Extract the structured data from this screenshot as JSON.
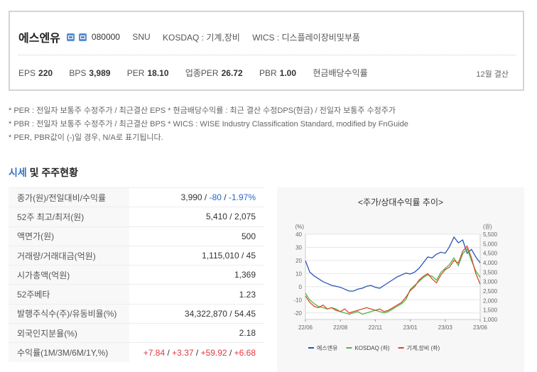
{
  "company": {
    "name": "에스엔유",
    "code": "080000",
    "eng": "SNU",
    "market": "KOSDAQ : 기계,장비",
    "wics": "WICS : 디스플레이장비및부품"
  },
  "metrics": [
    {
      "key": "EPS",
      "val": "220"
    },
    {
      "key": "BPS",
      "val": "3,989"
    },
    {
      "key": "PER",
      "val": "18.10"
    },
    {
      "key": "업종PER",
      "val": "26.72"
    },
    {
      "key": "PBR",
      "val": "1.00"
    },
    {
      "key": "현금배당수익률",
      "val": ""
    }
  ],
  "fiscal": "12월 결산",
  "notes": [
    "* PER : 전일자 보통주 수정주가 / 최근결산 EPS * 현금배당수익률 : 최근 결산 수정DPS(현금) / 전일자 보통주 수정주가",
    "* PBR : 전일자 보통주 수정주가 / 최근결산 BPS * WICS : WISE Industry Classification Standard, modified by FnGuide",
    "* PER, PBR값이 (-)일 경우, N/A로 표기됩니다."
  ],
  "section": {
    "a": "시세",
    "b": " 및 주주현황"
  },
  "rows": [
    {
      "label": "종가(원)/전일대비/수익률",
      "v1": "3,990",
      "v2": "-80",
      "v3": "-1.97%"
    },
    {
      "label": "52주 최고/최저(원)",
      "value": "5,410 / 2,075"
    },
    {
      "label": "액면가(원)",
      "value": "500"
    },
    {
      "label": "거래량/거래대금(억원)",
      "value": "1,115,010 / 45"
    },
    {
      "label": "시가총액(억원)",
      "value": "1,369"
    },
    {
      "label": "52주베타",
      "value": "1.23"
    },
    {
      "label": "발행주식수(주)/유동비율(%)",
      "value": "34,322,870 / 54.45"
    },
    {
      "label": "외국인지분율(%)",
      "value": "2.18"
    },
    {
      "label": "수익률(1M/3M/6M/1Y,%)",
      "r1": "+7.84",
      "r2": "+3.37",
      "r3": "+59.92",
      "r4": "+6.68"
    }
  ],
  "chart_data": {
    "type": "line",
    "title": "<주가/상대수익률 추이>",
    "left_unit": "(%)",
    "right_unit": "(원)",
    "y_left_ticks": [
      "40",
      "30",
      "20",
      "10",
      "0",
      "-10",
      "-20"
    ],
    "y_right_ticks": [
      "5,500",
      "5,000",
      "4,500",
      "4,000",
      "3,500",
      "3,000",
      "2,500",
      "2,000",
      "1,500",
      "1,000"
    ],
    "x_ticks": [
      "22/06",
      "22/08",
      "22/11",
      "23/01",
      "23/03",
      "23/06"
    ],
    "ylim_left": [
      -25,
      40
    ],
    "ylim_right": [
      1000,
      5500
    ],
    "series": [
      {
        "name": "에스엔유",
        "color": "#2a55b4",
        "axis": "right",
        "values": [
          4100,
          3500,
          3300,
          3150,
          3000,
          2900,
          2800,
          2750,
          2700,
          2600,
          2500,
          2500,
          2600,
          2650,
          2750,
          2800,
          2700,
          2650,
          2800,
          2950,
          3100,
          3250,
          3350,
          3450,
          3400,
          3500,
          3700,
          4000,
          4300,
          4250,
          4450,
          4550,
          4500,
          4850,
          5350,
          5050,
          5200,
          4500,
          4700,
          4300,
          3990
        ]
      },
      {
        "name": "KOSDAQ (좌)",
        "color": "#4db84a",
        "axis": "left",
        "values": [
          -5,
          -10,
          -13,
          -15,
          -16,
          -17,
          -16,
          -17,
          -19,
          -20,
          -21,
          -20,
          -19,
          -21,
          -20,
          -19,
          -18,
          -19,
          -20,
          -19,
          -17,
          -15,
          -13,
          -10,
          -2,
          1,
          4,
          7,
          9,
          8,
          5,
          11,
          14,
          17,
          22,
          16,
          25,
          29,
          20,
          12,
          7
        ]
      },
      {
        "name": "기계,장비 (좌)",
        "color": "#d24a30",
        "axis": "left",
        "values": [
          -7,
          -12,
          -15,
          -16,
          -14,
          -17,
          -16,
          -18,
          -19,
          -17,
          -20,
          -19,
          -18,
          -17,
          -16,
          -17,
          -18,
          -17,
          -19,
          -18,
          -16,
          -14,
          -12,
          -8,
          -3,
          0,
          5,
          8,
          10,
          6,
          3,
          9,
          13,
          15,
          20,
          18,
          27,
          31,
          22,
          10,
          2
        ]
      }
    ]
  }
}
